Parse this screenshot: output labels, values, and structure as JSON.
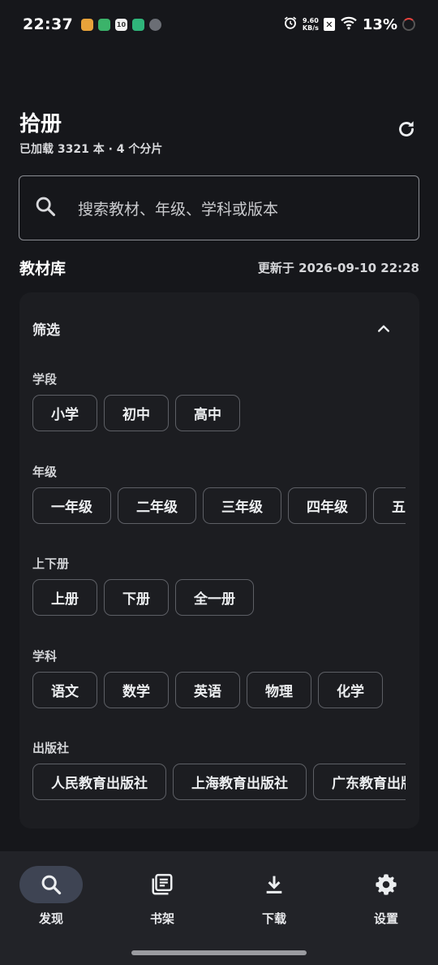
{
  "status_bar": {
    "time": "22:37",
    "net_speed_value": "9.60",
    "net_speed_unit": "KB/s",
    "battery": "13%",
    "notification_icons": [
      "app-orange-icon",
      "app-green-person-icon",
      "calendar-10-icon",
      "app-green-square-icon",
      "avatar-icon"
    ],
    "calendar_day": "10"
  },
  "header": {
    "title": "拾册",
    "subtitle": "已加载 3321 本 · 4 个分片"
  },
  "search": {
    "placeholder": "搜索教材、年级、学科或版本"
  },
  "library": {
    "title": "教材库",
    "updated": "更新于 2026-09-10 22:28"
  },
  "filter": {
    "title": "筛选",
    "sections": [
      {
        "label": "学段",
        "chips": [
          "小学",
          "初中",
          "高中"
        ]
      },
      {
        "label": "年级",
        "chips": [
          "一年级",
          "二年级",
          "三年级",
          "四年级",
          "五年级"
        ]
      },
      {
        "label": "上下册",
        "chips": [
          "上册",
          "下册",
          "全一册"
        ]
      },
      {
        "label": "学科",
        "chips": [
          "语文",
          "数学",
          "英语",
          "物理",
          "化学"
        ]
      },
      {
        "label": "出版社",
        "chips": [
          "人民教育出版社",
          "上海教育出版社",
          "广东教育出版社"
        ]
      }
    ]
  },
  "bottom_nav": {
    "items": [
      {
        "label": "发现",
        "icon": "search-icon"
      },
      {
        "label": "书架",
        "icon": "library-icon"
      },
      {
        "label": "下载",
        "icon": "download-icon"
      },
      {
        "label": "设置",
        "icon": "gear-icon"
      }
    ]
  },
  "colors": {
    "background": "#16171b",
    "card": "#1c1d21",
    "nav_bar": "#222328",
    "active_pill": "#3e4453",
    "chip_border": "#5d5f65"
  }
}
